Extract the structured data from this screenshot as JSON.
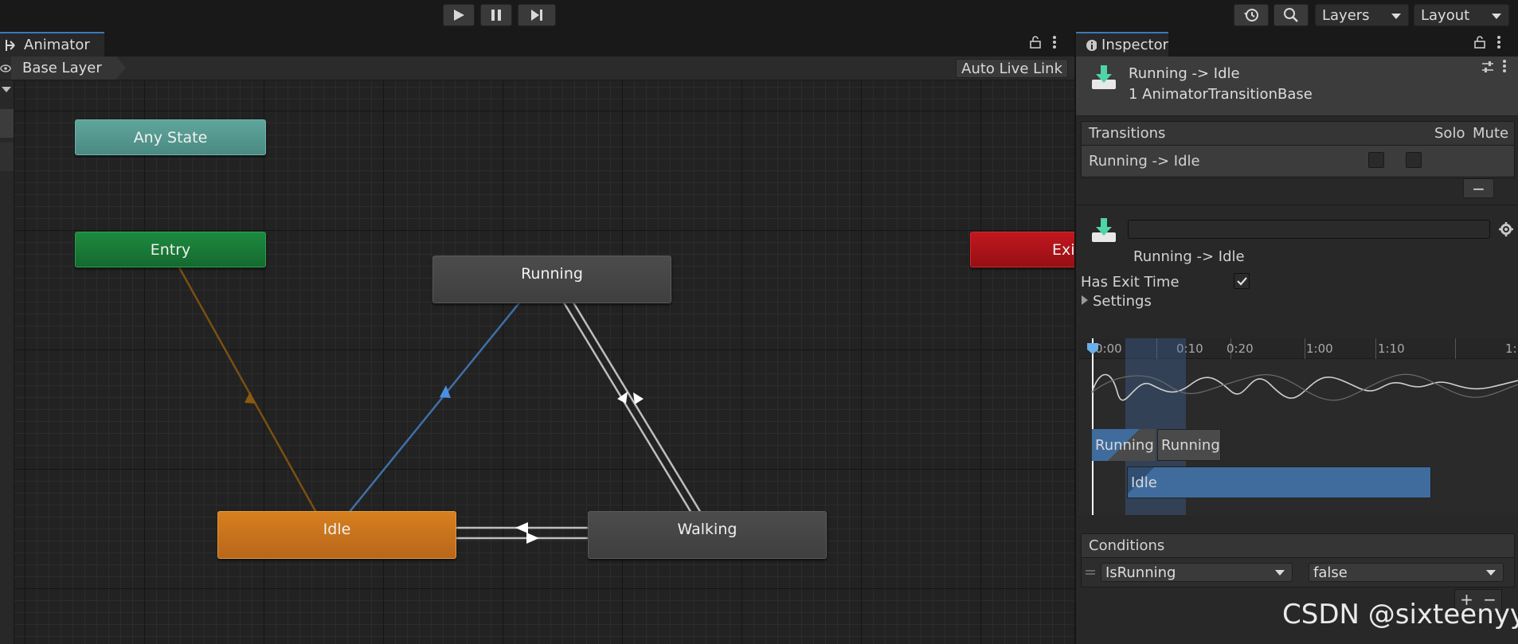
{
  "toolbar": {
    "play_icon": "play-icon",
    "pause_icon": "pause-icon",
    "step_icon": "step-icon",
    "history_icon": "history-icon",
    "search_icon": "search-icon",
    "layers_label": "Layers",
    "layout_label": "Layout"
  },
  "animator": {
    "tab_label": "Animator",
    "breadcrumb": "Base Layer",
    "auto_live_link": "Auto Live Link",
    "nodes": {
      "any_state": "Any State",
      "entry": "Entry",
      "exit": "Exit",
      "running": "Running",
      "idle": "Idle",
      "walking": "Walking"
    },
    "colors": {
      "default_state": "#d7801f",
      "entry": "#1d8a3f",
      "any_state": "#5fa59c",
      "exit": "#c0181e",
      "selected_transition": "#4a90e2",
      "default_transition": "#8a5a10"
    }
  },
  "inspector": {
    "tab_label": "Inspector",
    "header": {
      "title": "Running -> Idle",
      "subtitle": "1 AnimatorTransitionBase"
    },
    "transitions": {
      "header": "Transitions",
      "solo_label": "Solo",
      "mute_label": "Mute",
      "rows": [
        {
          "name": "Running -> Idle",
          "solo": false,
          "mute": false
        }
      ],
      "remove_label": "−"
    },
    "detail": {
      "name_value": "",
      "transition_label": "Running -> Idle"
    },
    "has_exit_time": {
      "label": "Has Exit Time",
      "checked": true
    },
    "settings_label": "Settings",
    "timeline": {
      "labels": [
        "0:00",
        "0:10",
        "0:20",
        "1:00",
        "1:10",
        "1:"
      ],
      "clips": {
        "source_1": "Running",
        "source_2": "Running",
        "destination": "Idle"
      }
    },
    "conditions": {
      "header": "Conditions",
      "rows": [
        {
          "parameter": "IsRunning",
          "value": "false"
        }
      ],
      "add_label": "+",
      "remove_label": "−"
    }
  },
  "watermark": "CSDN @sixteenyy"
}
